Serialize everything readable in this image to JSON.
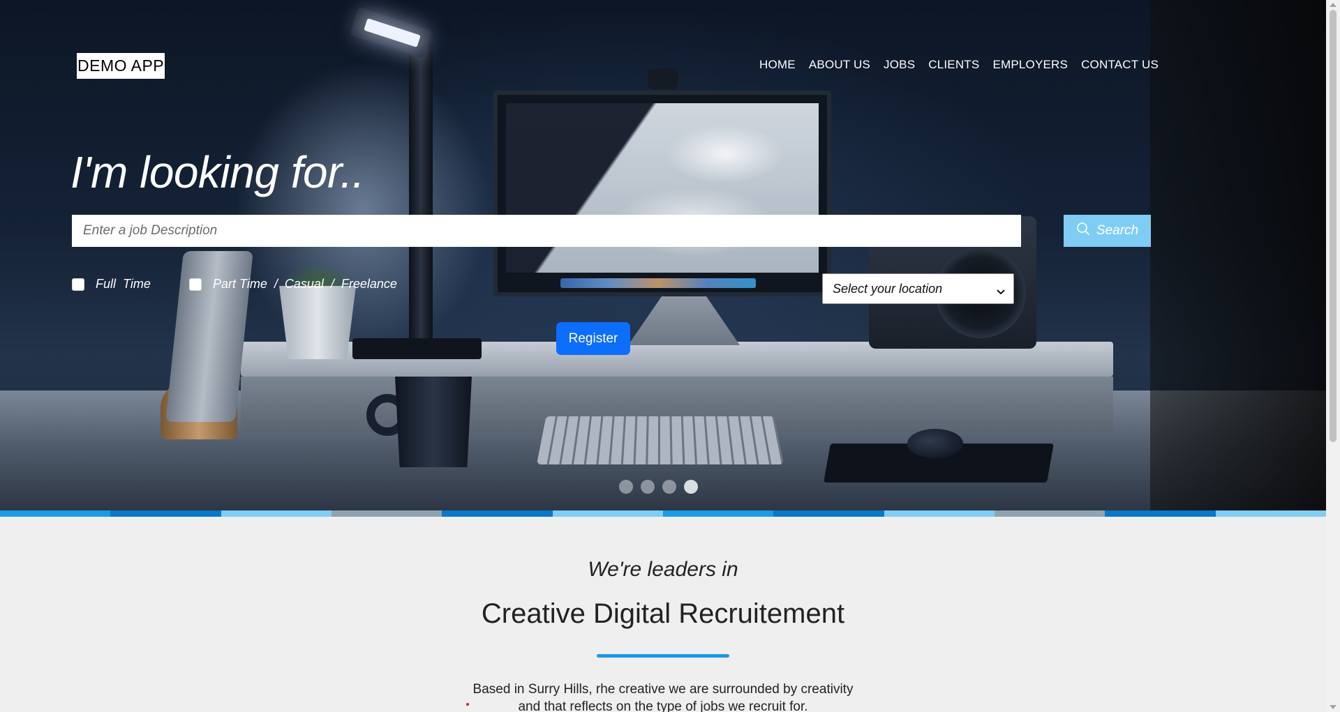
{
  "header": {
    "logo": "DEMO APP",
    "nav": [
      "HOME",
      "ABOUT US",
      "JOBS",
      "CLIENTS",
      "EMPLOYERS",
      "CONTACT US"
    ]
  },
  "hero": {
    "headline": "I'm looking for..",
    "search_placeholder": "Enter a job Description",
    "search_button": "Search",
    "full_time_label": "Full  Time",
    "part_time_label": "Part Time  /  Casual  /  Freelance",
    "full_time_checked": false,
    "part_time_checked": false,
    "location_selected": "Select your location",
    "register_button": "Register",
    "carousel_slides": 4,
    "carousel_active_index": 3
  },
  "stripe_colors": [
    "#1a9be6",
    "#0a78c8",
    "#7fcdf5",
    "#8fa3b3",
    "#0a78c8",
    "#7fcdf5",
    "#1a9be6",
    "#0a78c8",
    "#7fcdf5",
    "#8fa3b3",
    "#0a78c8",
    "#7fcdf5"
  ],
  "colors": {
    "accent": "#0d6efd",
    "search_button": "#7fcdf5",
    "underline": "#1a9be6",
    "background": "#efefef"
  },
  "section": {
    "pretitle": "We're leaders in",
    "title": "Creative Digital Recruitement",
    "description_line1": "Based in Surry Hills, rhe creative we are surrounded by creativity",
    "description_line2": "and that reflects on the type of jobs we recruit for."
  },
  "icons": {
    "search": "search-icon",
    "select_caret": "chevron-down-icon"
  }
}
